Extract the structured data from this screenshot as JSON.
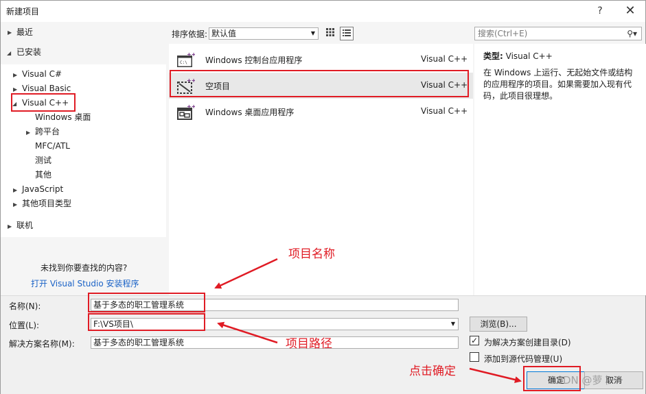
{
  "window": {
    "title": "新建项目",
    "help": "?",
    "close": "✕"
  },
  "tree": {
    "recent": "最近",
    "installed": "已安装",
    "items": {
      "csharp": "Visual C#",
      "vb": "Visual Basic",
      "cpp": "Visual C++",
      "windesktop": "Windows 桌面",
      "crossplat": "跨平台",
      "mfc": "MFC/ATL",
      "test": "测试",
      "other": "其他",
      "js": "JavaScript",
      "othertypes": "其他项目类型"
    },
    "online": "联机",
    "not_found": "未找到你要查找的内容?",
    "open_installer": "打开 Visual Studio 安装程序"
  },
  "sortbar": {
    "label": "排序依据:",
    "value": "默认值"
  },
  "search": {
    "placeholder": "搜索(Ctrl+E)"
  },
  "templates": [
    {
      "name": "Windows 控制台应用程序",
      "lang": "Visual C++"
    },
    {
      "name": "空项目",
      "lang": "Visual C++"
    },
    {
      "name": "Windows 桌面应用程序",
      "lang": "Visual C++"
    }
  ],
  "details": {
    "type_label": "类型:",
    "type_value": "Visual C++",
    "description": "在 Windows 上运行、无起始文件或结构的应用程序的项目。如果需要加入现有代码，此项目很理想。"
  },
  "form": {
    "name_label": "名称(N):",
    "name_value": "基于多态的职工管理系统",
    "location_label": "位置(L):",
    "location_value": "F:\\VS项目\\",
    "solution_label": "解决方案名称(M):",
    "solution_value": "基于多态的职工管理系统",
    "browse": "浏览(B)...",
    "create_dir": "为解决方案创建目录(D)",
    "create_dir_checked": true,
    "add_source": "添加到源代码管理(U)",
    "add_source_checked": false,
    "ok": "确定",
    "cancel": "取消"
  },
  "annotations": {
    "project_name": "项目名称",
    "project_path": "项目路径",
    "click_ok": "点击确定"
  },
  "watermark": "CSDN @萝卜一",
  "colors": {
    "annotation": "#e01b24",
    "link": "#1a62c6"
  }
}
